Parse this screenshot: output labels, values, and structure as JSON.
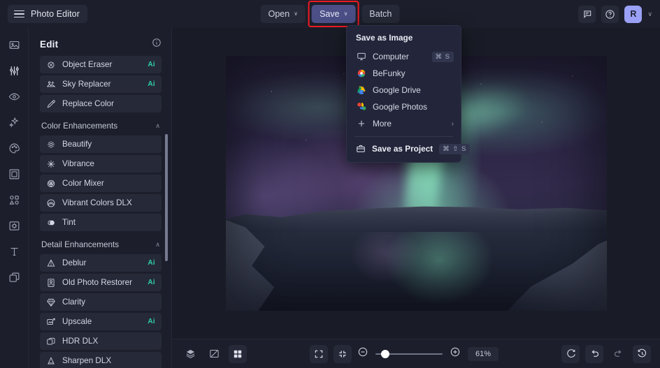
{
  "app": {
    "brand_label": "Photo Editor",
    "menu_icon": "hamburger-icon"
  },
  "toolbar": {
    "open_label": "Open",
    "save_label": "Save",
    "batch_label": "Batch",
    "caret": "∨",
    "accent_color": "#4b4f86",
    "highlight_color": "#ee1a22"
  },
  "top_right": {
    "feedback_icon": "comment-icon",
    "help_icon": "help-circle-icon",
    "avatar_initial": "R",
    "avatar_color": "#9aa0f5",
    "avatar_caret": "∨"
  },
  "rail": {
    "items": [
      {
        "name": "photo-icon"
      },
      {
        "name": "sliders-icon"
      },
      {
        "name": "eye-icon"
      },
      {
        "name": "sparkles-icon"
      },
      {
        "name": "palette-icon"
      },
      {
        "name": "frame-icon"
      },
      {
        "name": "shapes-icon"
      },
      {
        "name": "texture-icon"
      },
      {
        "name": "text-icon"
      },
      {
        "name": "layers-icon"
      }
    ]
  },
  "panel": {
    "title": "Edit",
    "info_icon": "info-icon",
    "sections": [
      {
        "kind": "tools",
        "items": [
          {
            "label": "Object Eraser",
            "icon": "object-eraser-icon",
            "badge": "Ai"
          },
          {
            "label": "Sky Replacer",
            "icon": "sky-replacer-icon",
            "badge": "Ai"
          },
          {
            "label": "Replace Color",
            "icon": "eyedropper-icon",
            "badge": ""
          }
        ]
      },
      {
        "kind": "group",
        "title": "Color Enhancements",
        "chevron": "∧",
        "items": [
          {
            "label": "Beautify",
            "icon": "beautify-icon",
            "badge": ""
          },
          {
            "label": "Vibrance",
            "icon": "vibrance-icon",
            "badge": ""
          },
          {
            "label": "Color Mixer",
            "icon": "color-mixer-icon",
            "badge": ""
          },
          {
            "label": "Vibrant Colors DLX",
            "icon": "vibrant-colors-icon",
            "badge": ""
          },
          {
            "label": "Tint",
            "icon": "tint-icon",
            "badge": ""
          }
        ]
      },
      {
        "kind": "group",
        "title": "Detail Enhancements",
        "chevron": "∧",
        "items": [
          {
            "label": "Deblur",
            "icon": "deblur-icon",
            "badge": "Ai"
          },
          {
            "label": "Old Photo Restorer",
            "icon": "old-photo-restorer-icon",
            "badge": "Ai"
          },
          {
            "label": "Clarity",
            "icon": "clarity-icon",
            "badge": ""
          },
          {
            "label": "Upscale",
            "icon": "upscale-icon",
            "badge": "Ai"
          },
          {
            "label": "HDR DLX",
            "icon": "hdr-icon",
            "badge": ""
          },
          {
            "label": "Sharpen DLX",
            "icon": "sharpen-icon",
            "badge": ""
          }
        ]
      }
    ],
    "ai_badge_color": "#2ecfa8"
  },
  "save_menu": {
    "title": "Save as Image",
    "items": [
      {
        "label": "Computer",
        "icon": "monitor-icon",
        "shortcut": "⌘ S"
      },
      {
        "label": "BeFunky",
        "icon": "befunky-icon",
        "shortcut": ""
      },
      {
        "label": "Google Drive",
        "icon": "google-drive-icon",
        "shortcut": ""
      },
      {
        "label": "Google Photos",
        "icon": "google-photos-icon",
        "shortcut": ""
      },
      {
        "label": "More",
        "icon": "plus-icon",
        "shortcut": "",
        "submenu": "›"
      }
    ],
    "project": {
      "label": "Save as Project",
      "icon": "briefcase-icon",
      "shortcut": "⌘ ⇧ S"
    }
  },
  "canvas": {
    "image_alt": "aurora-borealis-over-lake"
  },
  "bottombar": {
    "left_buttons": [
      {
        "name": "layers-panel-button",
        "icon": "stack-icon"
      },
      {
        "name": "compare-button",
        "icon": "compare-icon"
      },
      {
        "name": "grid-button",
        "icon": "grid-icon"
      }
    ],
    "view_buttons": [
      {
        "name": "fit-screen-button",
        "icon": "expand-frame-icon"
      },
      {
        "name": "actual-size-button",
        "icon": "collapse-arrows-icon"
      }
    ],
    "zoom_out_icon": "zoom-out-icon",
    "zoom_in_icon": "zoom-in-icon",
    "zoom_value": "61%",
    "zoom_slider_percent": 8,
    "right_buttons": [
      {
        "name": "reset-button",
        "icon": "refresh-icon"
      },
      {
        "name": "undo-button",
        "icon": "undo-arrow-icon"
      },
      {
        "name": "redo-button",
        "icon": "redo-arrow-icon"
      },
      {
        "name": "history-button",
        "icon": "history-clock-icon"
      }
    ]
  }
}
